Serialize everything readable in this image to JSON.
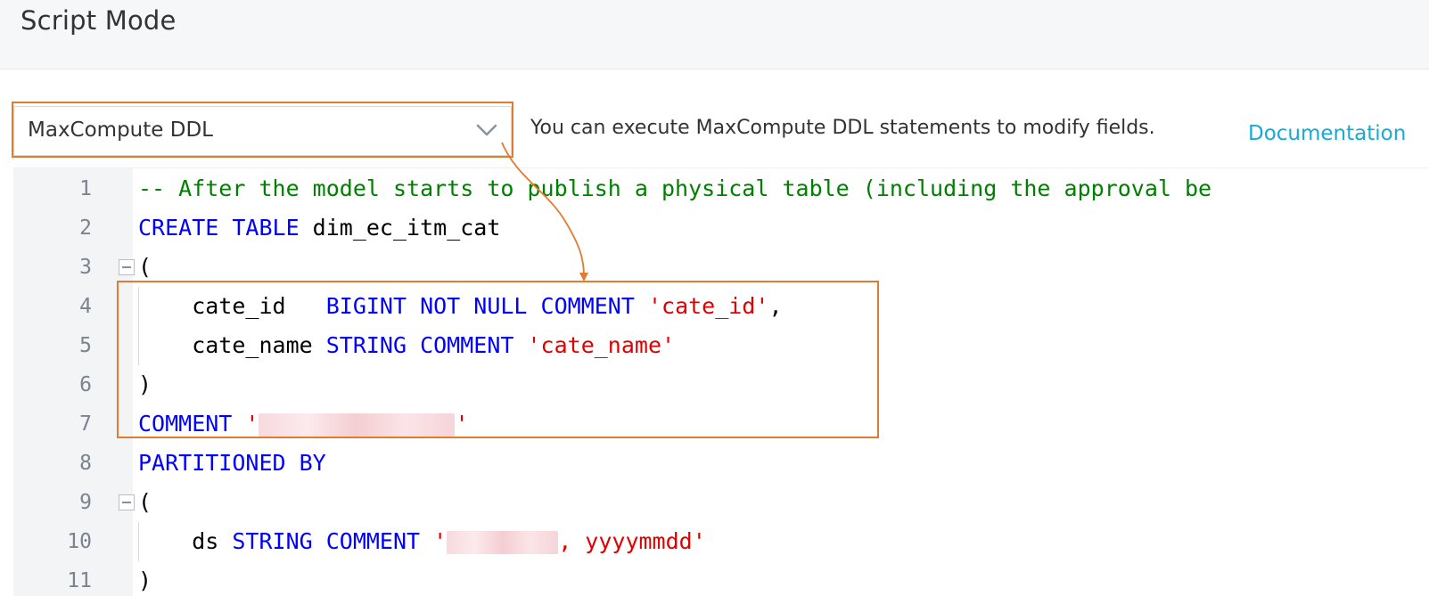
{
  "header": {
    "title": "Script Mode"
  },
  "toolbar": {
    "mode_select": "MaxCompute DDL",
    "hint": "You can execute MaxCompute DDL statements to modify fields.",
    "doc_link": "Documentation"
  },
  "editor": {
    "lines": [
      {
        "num": "1",
        "tokens": [
          {
            "t": "-- After the model starts to publish a physical table (including the approval be",
            "c": "comment"
          }
        ]
      },
      {
        "num": "2",
        "tokens": [
          {
            "t": "CREATE TABLE",
            "c": "kw"
          },
          {
            "t": " dim_ec_itm_cat",
            "c": "plain"
          }
        ]
      },
      {
        "num": "3",
        "tokens": [
          {
            "t": "(",
            "c": "plain"
          }
        ]
      },
      {
        "num": "4",
        "tokens": [
          {
            "t": "    cate_id   ",
            "c": "plain"
          },
          {
            "t": "BIGINT NOT NULL COMMENT",
            "c": "kw"
          },
          {
            "t": " ",
            "c": "plain"
          },
          {
            "t": "'cate_id'",
            "c": "str"
          },
          {
            "t": ",",
            "c": "plain"
          }
        ]
      },
      {
        "num": "5",
        "tokens": [
          {
            "t": "    cate_name ",
            "c": "plain"
          },
          {
            "t": "STRING COMMENT",
            "c": "kw"
          },
          {
            "t": " ",
            "c": "plain"
          },
          {
            "t": "'cate_name'",
            "c": "str"
          }
        ]
      },
      {
        "num": "6",
        "tokens": [
          {
            "t": ")",
            "c": "plain"
          }
        ]
      },
      {
        "num": "7",
        "tokens": [
          {
            "t": "COMMENT",
            "c": "kw"
          },
          {
            "t": " ",
            "c": "plain"
          },
          {
            "t": "'",
            "c": "str"
          },
          {
            "blur": 220
          },
          {
            "t": "'",
            "c": "str"
          }
        ]
      },
      {
        "num": "8",
        "tokens": [
          {
            "t": "PARTITIONED BY",
            "c": "kw"
          }
        ]
      },
      {
        "num": "9",
        "tokens": [
          {
            "t": "(",
            "c": "plain"
          }
        ]
      },
      {
        "num": "10",
        "tokens": [
          {
            "t": "    ds ",
            "c": "plain"
          },
          {
            "t": "STRING COMMENT",
            "c": "kw"
          },
          {
            "t": " ",
            "c": "plain"
          },
          {
            "t": "'",
            "c": "str"
          },
          {
            "blur": 125
          },
          {
            "t": ", yyyymmdd'",
            "c": "str"
          }
        ]
      },
      {
        "num": "11",
        "tokens": [
          {
            "t": ")",
            "c": "plain"
          }
        ]
      }
    ]
  }
}
